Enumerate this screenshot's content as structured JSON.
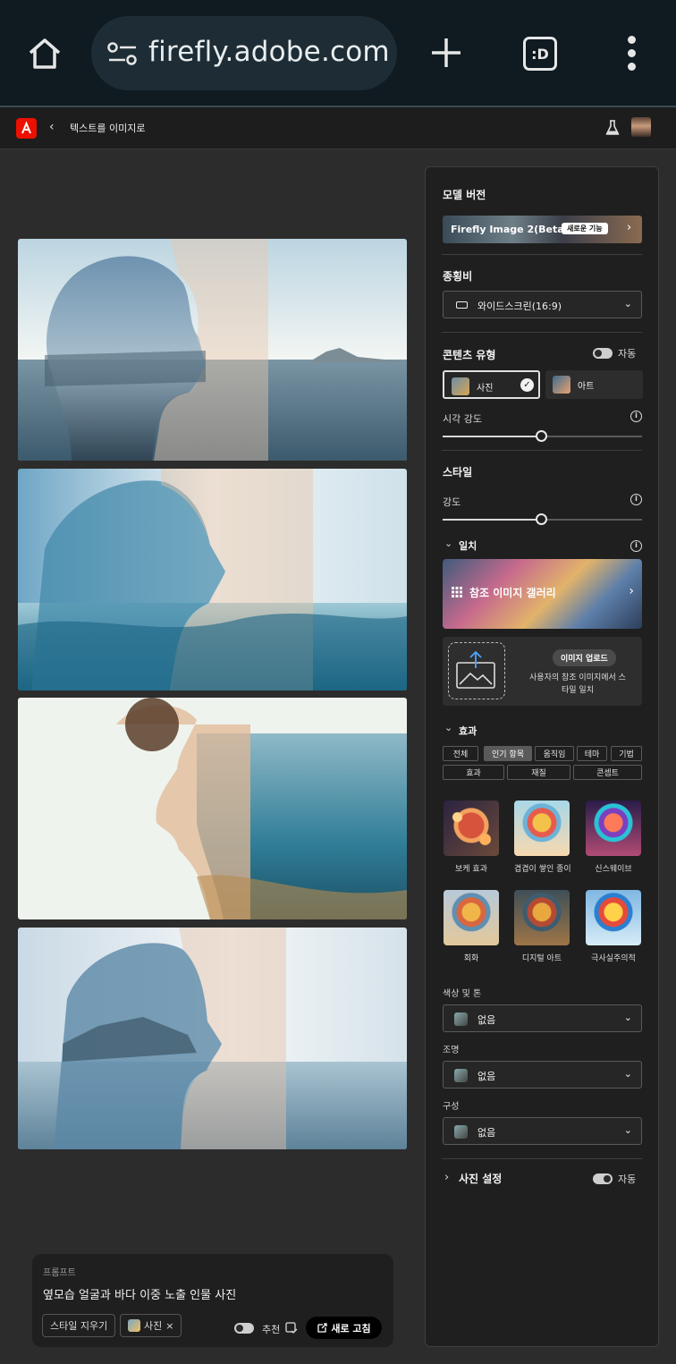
{
  "browser": {
    "url": "firefly.adobe.com",
    "tab_glyph": ":D"
  },
  "header": {
    "back": "‹",
    "breadcrumb": "텍스트를 이미지로"
  },
  "prompt": {
    "label": "프롬프트",
    "text": "옆모습 얼굴과 바다 이중 노출 인물 사진",
    "clear_style": "스타일 지우기",
    "photo_chip": "사진",
    "chip_close": "×",
    "recommend": "추천",
    "refresh": "새로 고침"
  },
  "panel": {
    "model": {
      "heading": "모델 버전",
      "name": "Firefly Image 2(Beta)",
      "badge": "새로운 기능"
    },
    "aspect": {
      "heading": "종횡비",
      "value": "와이드스크린(16:9)"
    },
    "content_type": {
      "heading": "콘텐츠 유형",
      "auto": "자동",
      "options": [
        "사진",
        "아트"
      ],
      "selected": "사진",
      "visual_intensity": "시각 강도",
      "visual_intensity_level": 0.5
    },
    "style": {
      "heading": "스타일",
      "strength": "강도",
      "strength_level": 0.5
    },
    "match": {
      "heading": "일치",
      "gallery": "참조 이미지 갤러리",
      "upload_button": "이미지 업로드",
      "upload_desc": "사용자의 참조 이미지에서 스타일 일치"
    },
    "effects": {
      "heading": "효과",
      "filters_row1": [
        "전체",
        "인기 항목",
        "움직임",
        "테마",
        "기법"
      ],
      "filters_row2": [
        "효과",
        "재질",
        "콘셉트"
      ],
      "active_filter": "인기 항목",
      "items": [
        "보케 효과",
        "겹겹이 쌓인 종이",
        "신스웨이브",
        "회화",
        "디지털 아트",
        "극사실주의적"
      ]
    },
    "color_tone": {
      "label": "색상 및 톤",
      "value": "없음"
    },
    "lighting": {
      "label": "조명",
      "value": "없음"
    },
    "composition": {
      "label": "구성",
      "value": "없음"
    },
    "photo_settings": {
      "heading": "사진 설정",
      "auto": "자동"
    }
  },
  "colors": {
    "adobe_red": "#eb1000",
    "panel_bg": "#1f1f1f",
    "page_bg": "#2c2c2c"
  }
}
